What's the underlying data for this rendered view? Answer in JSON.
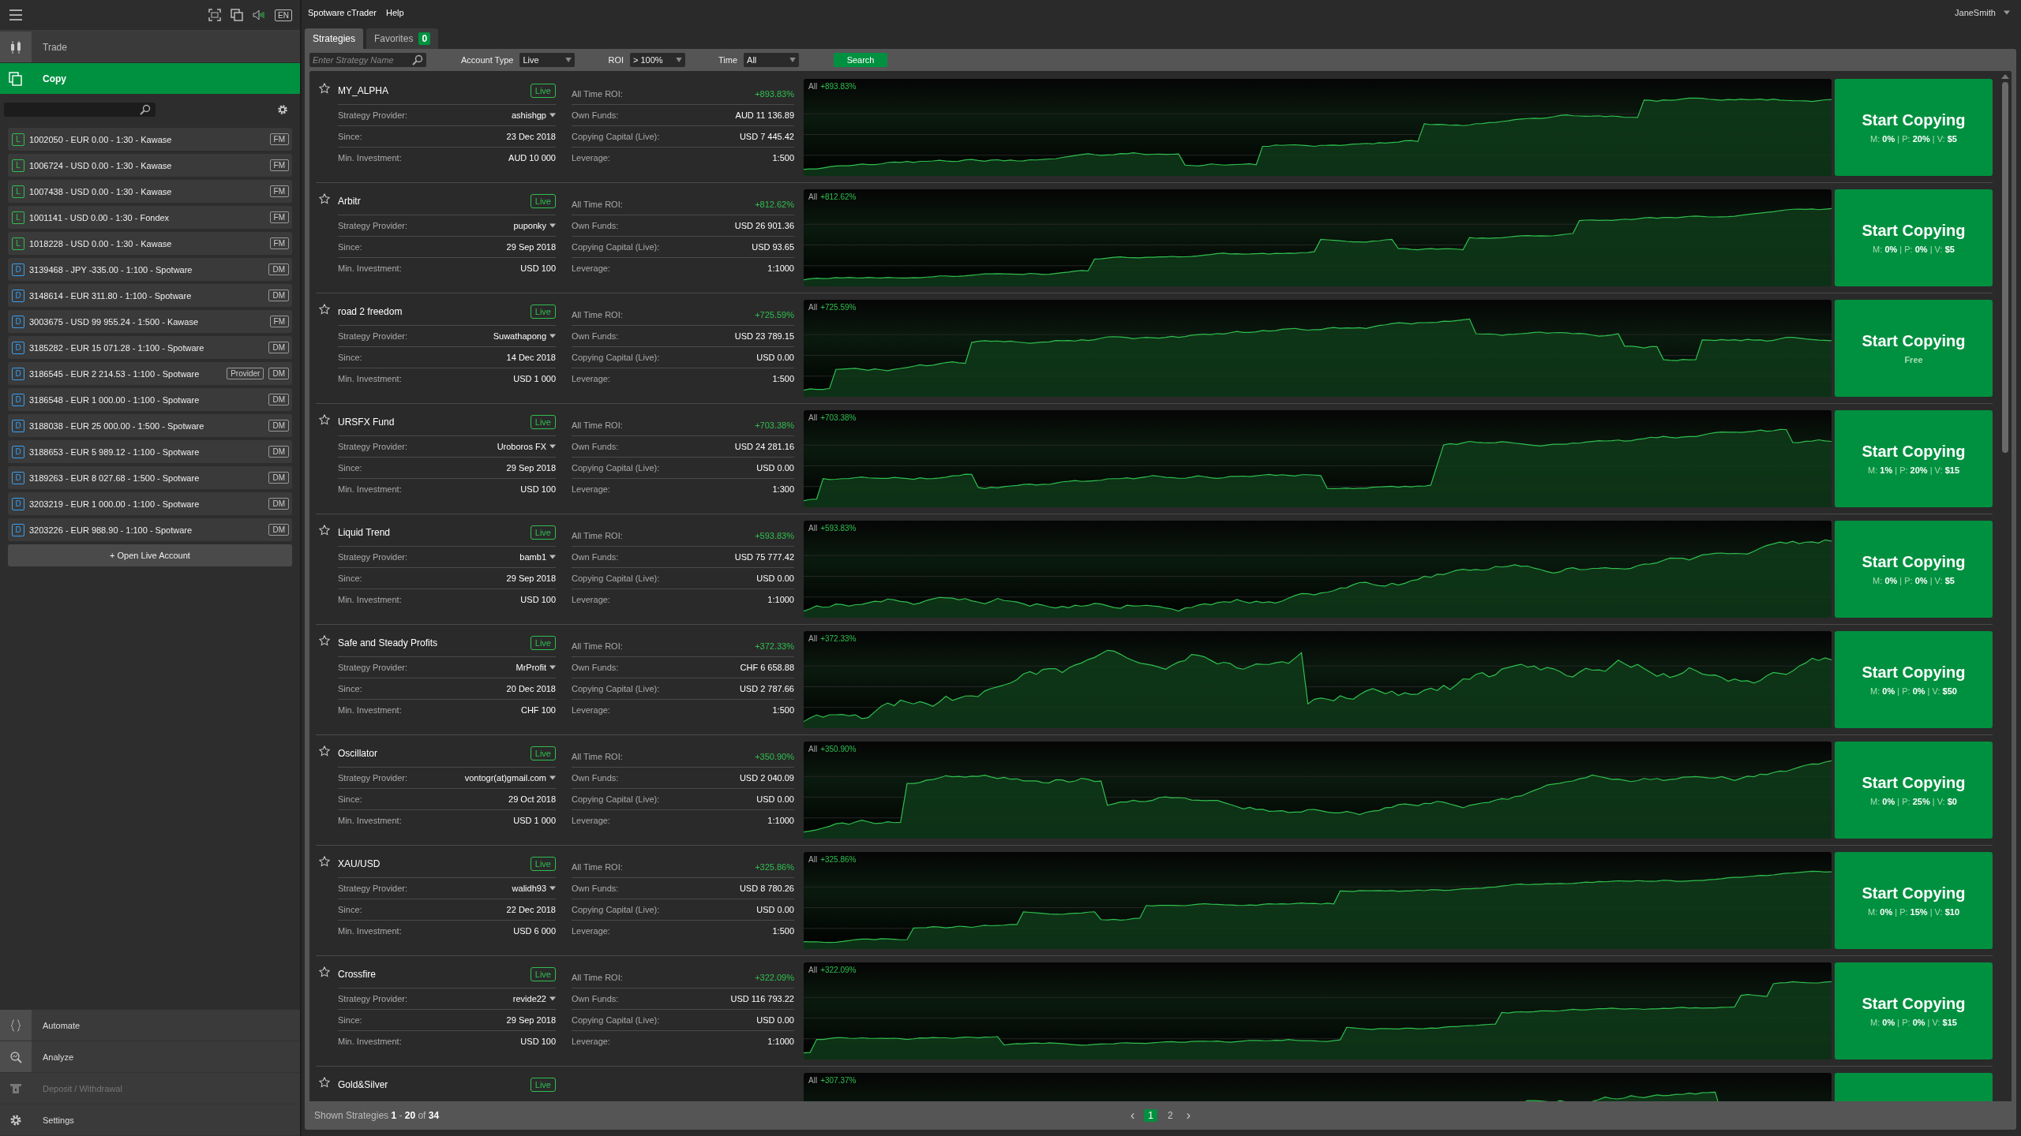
{
  "sidebar": {
    "language": "EN",
    "nav": [
      {
        "label": "Trade",
        "kind": "trade",
        "selected": false
      },
      {
        "label": "Copy",
        "kind": "copy",
        "selected": true
      }
    ],
    "accounts": [
      {
        "badge": "L",
        "kind": "live",
        "label": "1002050 - EUR 0.00 - 1:30 - Kawase",
        "tags": [
          "FM"
        ]
      },
      {
        "badge": "L",
        "kind": "live",
        "label": "1006724 - USD 0.00 - 1:30 - Kawase",
        "tags": [
          "FM"
        ]
      },
      {
        "badge": "L",
        "kind": "live",
        "label": "1007438 - USD 0.00 - 1:30 - Kawase",
        "tags": [
          "FM"
        ]
      },
      {
        "badge": "L",
        "kind": "live",
        "label": "1001141 - USD 0.00 - 1:30 - Fondex",
        "tags": [
          "FM"
        ]
      },
      {
        "badge": "L",
        "kind": "live",
        "label": "1018228 - USD 0.00 - 1:30 - Kawase",
        "tags": [
          "FM"
        ]
      },
      {
        "badge": "D",
        "kind": "demo",
        "label": "3139468 - JPY -335.00 - 1:100 - Spotware",
        "tags": [
          "DM"
        ]
      },
      {
        "badge": "D",
        "kind": "demo",
        "label": "3148614 - EUR 311.80 - 1:100 - Spotware",
        "tags": [
          "DM"
        ]
      },
      {
        "badge": "D",
        "kind": "demo",
        "label": "3003675 - USD 99 955.24 - 1:500 - Kawase",
        "tags": [
          "FM"
        ]
      },
      {
        "badge": "D",
        "kind": "demo",
        "label": "3185282 - EUR 15 071.28 - 1:100 - Spotware",
        "tags": [
          "DM"
        ]
      },
      {
        "badge": "D",
        "kind": "demo",
        "label": "3186545 - EUR 2 214.53 - 1:100 - Spotware",
        "tags": [
          "Provider",
          "DM"
        ]
      },
      {
        "badge": "D",
        "kind": "demo",
        "label": "3186548 - EUR 1 000.00 - 1:100 - Spotware",
        "tags": [
          "DM"
        ]
      },
      {
        "badge": "D",
        "kind": "demo",
        "label": "3188038 - EUR 25 000.00 - 1:500 - Spotware",
        "tags": [
          "DM"
        ]
      },
      {
        "badge": "D",
        "kind": "demo",
        "label": "3188653 - EUR 5 989.12 - 1:100 - Spotware",
        "tags": [
          "DM"
        ]
      },
      {
        "badge": "D",
        "kind": "demo",
        "label": "3189263 - EUR 8 027.68 - 1:500 - Spotware",
        "tags": [
          "DM"
        ]
      },
      {
        "badge": "D",
        "kind": "demo",
        "label": "3203219 - EUR 1 000.00 - 1:100 - Spotware",
        "tags": [
          "DM"
        ]
      },
      {
        "badge": "D",
        "kind": "demo",
        "label": "3203226 - EUR 988.90 - 1:100 - Spotware",
        "tags": [
          "DM"
        ]
      }
    ],
    "open_account": "+ Open Live Account",
    "bottom_nav": [
      {
        "label": "Automate",
        "kind": "automate",
        "selected": false,
        "disabled": false
      },
      {
        "label": "Analyze",
        "kind": "analyze",
        "selected": false,
        "disabled": false
      },
      {
        "label": "Deposit / Withdrawal",
        "kind": "deposit",
        "selected": false,
        "disabled": true
      },
      {
        "label": "Settings",
        "kind": "settings",
        "selected": false,
        "disabled": false
      }
    ]
  },
  "menu_bar": {
    "items": [
      "Spotware cTrader",
      "Help"
    ],
    "user": "JaneSmith"
  },
  "tabs": [
    {
      "label": "Strategies",
      "selected": true
    },
    {
      "label": "Favorites",
      "selected": false,
      "count": "0"
    }
  ],
  "filters": {
    "search": {
      "placeholder": "Enter Strategy Name"
    },
    "selects": [
      {
        "label": "Account Type",
        "value": "Live"
      },
      {
        "label": "ROI",
        "value": "> 100%"
      },
      {
        "label": "Time",
        "value": "All"
      }
    ],
    "button": "Search"
  },
  "strategies": [
    {
      "name": "MY_ALPHA",
      "favorite": false,
      "badge": "Live",
      "left": [
        {
          "label": "Strategy Provider:",
          "value": "ashishgp",
          "kind": "provider"
        },
        {
          "label": "Since:",
          "value": "23 Dec 2018",
          "kind": "plain"
        },
        {
          "label": "Min. Investment:",
          "value": "AUD 10 000",
          "kind": "plain"
        }
      ],
      "right": [
        {
          "label": "All Time ROI:",
          "value": "+893.83%",
          "kind": "roi"
        },
        {
          "label": "Own Funds:",
          "value": "AUD 11 136.89",
          "kind": "plain"
        },
        {
          "label": "Copying Capital (Live):",
          "value": "USD 7 445.42",
          "kind": "plain"
        },
        {
          "label": "Leverage:",
          "value": "1:500",
          "kind": "plain"
        }
      ],
      "chart_label": "All",
      "chart_roi": "+893.83%",
      "button": "Start Copying",
      "fee": {
        "kind": "paid",
        "text": "M: **0%** | P: **20%** | V: **$5**"
      }
    },
    {
      "name": "Arbitr",
      "favorite": false,
      "badge": "Live",
      "left": [
        {
          "label": "Strategy Provider:",
          "value": "puponky",
          "kind": "provider"
        },
        {
          "label": "Since:",
          "value": "29 Sep 2018",
          "kind": "plain"
        },
        {
          "label": "Min. Investment:",
          "value": "USD 100",
          "kind": "plain"
        }
      ],
      "right": [
        {
          "label": "All Time ROI:",
          "value": "+812.62%",
          "kind": "roi"
        },
        {
          "label": "Own Funds:",
          "value": "USD 26 901.36",
          "kind": "plain"
        },
        {
          "label": "Copying Capital (Live):",
          "value": "USD 93.65",
          "kind": "plain"
        },
        {
          "label": "Leverage:",
          "value": "1:1000",
          "kind": "plain"
        }
      ],
      "chart_label": "All",
      "chart_roi": "+812.62%",
      "button": "Start Copying",
      "fee": {
        "kind": "paid",
        "text": "M: **0%** | P: **0%** | V: **$5**"
      }
    },
    {
      "name": "road 2 freedom",
      "favorite": false,
      "badge": "Live",
      "left": [
        {
          "label": "Strategy Provider:",
          "value": "Suwathapong",
          "kind": "provider"
        },
        {
          "label": "Since:",
          "value": "14 Dec 2018",
          "kind": "plain"
        },
        {
          "label": "Min. Investment:",
          "value": "USD 1 000",
          "kind": "plain"
        }
      ],
      "right": [
        {
          "label": "All Time ROI:",
          "value": "+725.59%",
          "kind": "roi"
        },
        {
          "label": "Own Funds:",
          "value": "USD 23 789.15",
          "kind": "plain"
        },
        {
          "label": "Copying Capital (Live):",
          "value": "USD 0.00",
          "kind": "plain"
        },
        {
          "label": "Leverage:",
          "value": "1:500",
          "kind": "plain"
        }
      ],
      "chart_label": "All",
      "chart_roi": "+725.59%",
      "button": "Start Copying",
      "fee": {
        "kind": "free",
        "text": "Free"
      }
    },
    {
      "name": "URSFX Fund",
      "favorite": false,
      "badge": "Live",
      "left": [
        {
          "label": "Strategy Provider:",
          "value": "Uroboros FX",
          "kind": "provider"
        },
        {
          "label": "Since:",
          "value": "29 Sep 2018",
          "kind": "plain"
        },
        {
          "label": "Min. Investment:",
          "value": "USD 100",
          "kind": "plain"
        }
      ],
      "right": [
        {
          "label": "All Time ROI:",
          "value": "+703.38%",
          "kind": "roi"
        },
        {
          "label": "Own Funds:",
          "value": "USD 24 281.16",
          "kind": "plain"
        },
        {
          "label": "Copying Capital (Live):",
          "value": "USD 0.00",
          "kind": "plain"
        },
        {
          "label": "Leverage:",
          "value": "1:300",
          "kind": "plain"
        }
      ],
      "chart_label": "All",
      "chart_roi": "+703.38%",
      "button": "Start Copying",
      "fee": {
        "kind": "paid",
        "text": "M: **1%** | P: **20%** | V: **$15**"
      }
    },
    {
      "name": "Liquid Trend",
      "favorite": false,
      "badge": "Live",
      "left": [
        {
          "label": "Strategy Provider:",
          "value": "bamb1",
          "kind": "provider"
        },
        {
          "label": "Since:",
          "value": "29 Sep 2018",
          "kind": "plain"
        },
        {
          "label": "Min. Investment:",
          "value": "USD 100",
          "kind": "plain"
        }
      ],
      "right": [
        {
          "label": "All Time ROI:",
          "value": "+593.83%",
          "kind": "roi"
        },
        {
          "label": "Own Funds:",
          "value": "USD 75 777.42",
          "kind": "plain"
        },
        {
          "label": "Copying Capital (Live):",
          "value": "USD 0.00",
          "kind": "plain"
        },
        {
          "label": "Leverage:",
          "value": "1:1000",
          "kind": "plain"
        }
      ],
      "chart_label": "All",
      "chart_roi": "+593.83%",
      "button": "Start Copying",
      "fee": {
        "kind": "paid",
        "text": "M: **0%** | P: **0%** | V: **$5**"
      }
    },
    {
      "name": "Safe and Steady Profits",
      "favorite": false,
      "badge": "Live",
      "left": [
        {
          "label": "Strategy Provider:",
          "value": "MrProfit",
          "kind": "provider"
        },
        {
          "label": "Since:",
          "value": "20 Dec 2018",
          "kind": "plain"
        },
        {
          "label": "Min. Investment:",
          "value": "CHF 100",
          "kind": "plain"
        }
      ],
      "right": [
        {
          "label": "All Time ROI:",
          "value": "+372.33%",
          "kind": "roi"
        },
        {
          "label": "Own Funds:",
          "value": "CHF 6 658.88",
          "kind": "plain"
        },
        {
          "label": "Copying Capital (Live):",
          "value": "USD 2 787.66",
          "kind": "plain"
        },
        {
          "label": "Leverage:",
          "value": "1:500",
          "kind": "plain"
        }
      ],
      "chart_label": "All",
      "chart_roi": "+372.33%",
      "button": "Start Copying",
      "fee": {
        "kind": "paid",
        "text": "M: **0%** | P: **0%** | V: **$50**"
      }
    },
    {
      "name": "Oscillator",
      "favorite": false,
      "badge": "Live",
      "left": [
        {
          "label": "Strategy Provider:",
          "value": "vontogr(at)gmail.com",
          "kind": "provider"
        },
        {
          "label": "Since:",
          "value": "29 Oct 2018",
          "kind": "plain"
        },
        {
          "label": "Min. Investment:",
          "value": "USD 1 000",
          "kind": "plain"
        }
      ],
      "right": [
        {
          "label": "All Time ROI:",
          "value": "+350.90%",
          "kind": "roi"
        },
        {
          "label": "Own Funds:",
          "value": "USD 2 040.09",
          "kind": "plain"
        },
        {
          "label": "Copying Capital (Live):",
          "value": "USD 0.00",
          "kind": "plain"
        },
        {
          "label": "Leverage:",
          "value": "1:1000",
          "kind": "plain"
        }
      ],
      "chart_label": "All",
      "chart_roi": "+350.90%",
      "button": "Start Copying",
      "fee": {
        "kind": "paid",
        "text": "M: **0%** | P: **25%** | V: **$0**"
      }
    },
    {
      "name": "XAU/USD",
      "favorite": false,
      "badge": "Live",
      "left": [
        {
          "label": "Strategy Provider:",
          "value": "walidh93",
          "kind": "provider"
        },
        {
          "label": "Since:",
          "value": "22 Dec 2018",
          "kind": "plain"
        },
        {
          "label": "Min. Investment:",
          "value": "USD 6 000",
          "kind": "plain"
        }
      ],
      "right": [
        {
          "label": "All Time ROI:",
          "value": "+325.86%",
          "kind": "roi"
        },
        {
          "label": "Own Funds:",
          "value": "USD 8 780.26",
          "kind": "plain"
        },
        {
          "label": "Copying Capital (Live):",
          "value": "USD 0.00",
          "kind": "plain"
        },
        {
          "label": "Leverage:",
          "value": "1:500",
          "kind": "plain"
        }
      ],
      "chart_label": "All",
      "chart_roi": "+325.86%",
      "button": "Start Copying",
      "fee": {
        "kind": "paid",
        "text": "M: **0%** | P: **15%** | V: **$10**"
      }
    },
    {
      "name": "Crossfire",
      "favorite": false,
      "badge": "Live",
      "left": [
        {
          "label": "Strategy Provider:",
          "value": "revide22",
          "kind": "provider"
        },
        {
          "label": "Since:",
          "value": "29 Sep 2018",
          "kind": "plain"
        },
        {
          "label": "Min. Investment:",
          "value": "USD 100",
          "kind": "plain"
        }
      ],
      "right": [
        {
          "label": "All Time ROI:",
          "value": "+322.09%",
          "kind": "roi"
        },
        {
          "label": "Own Funds:",
          "value": "USD 116 793.22",
          "kind": "plain"
        },
        {
          "label": "Copying Capital (Live):",
          "value": "USD 0.00",
          "kind": "plain"
        },
        {
          "label": "Leverage:",
          "value": "1:1000",
          "kind": "plain"
        }
      ],
      "chart_label": "All",
      "chart_roi": "+322.09%",
      "button": "Start Copying",
      "fee": {
        "kind": "paid",
        "text": "M: **0%** | P: **0%** | V: **$15**"
      }
    },
    {
      "name": "Gold&Silver",
      "favorite": false,
      "badge": "Live",
      "chart_label": "All",
      "chart_roi": "+307.37%"
    }
  ],
  "footer": {
    "summary": "Shown Strategies **1** - **20** of **34**",
    "prev": "‹",
    "next": "›",
    "pages": [
      {
        "label": "1",
        "selected": true
      },
      {
        "label": "2",
        "selected": false
      }
    ]
  }
}
